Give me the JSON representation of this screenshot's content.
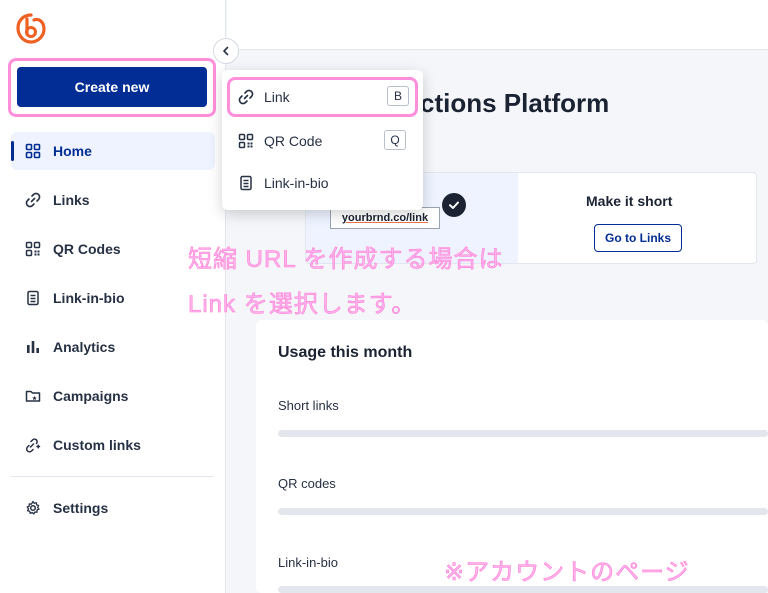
{
  "sidebar": {
    "create_label": "Create new",
    "items": [
      {
        "label": "Home",
        "icon": "home-grid-icon"
      },
      {
        "label": "Links",
        "icon": "link-icon"
      },
      {
        "label": "QR Codes",
        "icon": "qr-code-icon"
      },
      {
        "label": "Link-in-bio",
        "icon": "link-in-bio-icon"
      },
      {
        "label": "Analytics",
        "icon": "bar-chart-icon"
      },
      {
        "label": "Campaigns",
        "icon": "campaign-folder-icon"
      },
      {
        "label": "Custom links",
        "icon": "custom-link-icon"
      }
    ],
    "settings_label": "Settings"
  },
  "menu": {
    "items": [
      {
        "label": "Link",
        "shortcut": "B",
        "icon": "link-icon"
      },
      {
        "label": "QR Code",
        "shortcut": "Q",
        "icon": "qr-code-icon"
      },
      {
        "label": "Link-in-bio",
        "icon": "link-in-bio-icon"
      }
    ]
  },
  "main": {
    "title": "ctions Platform",
    "card": {
      "preview_link": "yourbrnd.co/link",
      "heading": "Make it short",
      "button_label": "Go to Links"
    },
    "usage": {
      "title": "Usage this month",
      "rows": [
        "Short links",
        "QR codes",
        "Link-in-bio"
      ]
    }
  },
  "annotations": {
    "line1": "短縮 URL を作成する場合は",
    "line2": "Link を選択します。",
    "footer": "※アカウントのページ"
  },
  "colors": {
    "brand": "#022d94",
    "logo": "#ee6123",
    "highlight": "#ff8fdb"
  }
}
